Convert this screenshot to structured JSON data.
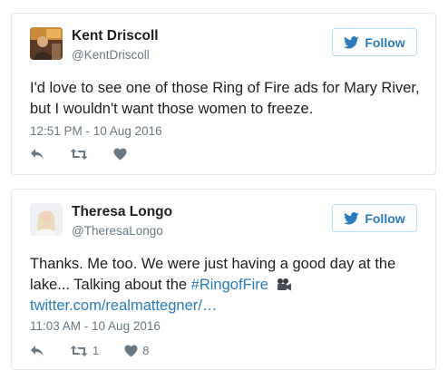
{
  "tweets": [
    {
      "author": "Kent Driscoll",
      "handle": "@KentDriscoll",
      "follow_label": "Follow",
      "text_line1": "I'd love to see one of those Ring of Fire ads for Mary River,",
      "text_line2": "but I wouldn't want those women to freeze.",
      "timestamp": "12:51 PM - 10 Aug 2016",
      "avatar_icon": "profile-photo-icon"
    },
    {
      "author": "Theresa Longo",
      "handle": "@TheresaLongo",
      "follow_label": "Follow",
      "text_line1": "Thanks. Me too. We were just having a good day at the",
      "text_prefix": "lake... Talking about the ",
      "hashtag": "#RingofFire",
      "emoji_icon": "movie-camera-icon",
      "link": "twitter.com/realmattegner/…",
      "timestamp": "11:03 AM - 10 Aug 2016",
      "retweet_count": "1",
      "like_count": "8",
      "avatar_icon": "profile-photo-icon"
    }
  ],
  "colors": {
    "link": "#2b7bb9",
    "muted": "#697882",
    "border": "#e1e8ed",
    "follow_border": "#b6dff8",
    "twitter_blue": "#1da1f2"
  }
}
